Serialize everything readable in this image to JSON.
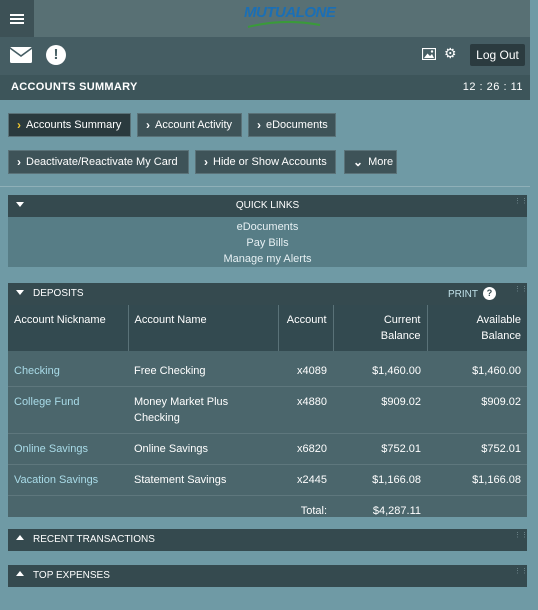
{
  "header": {
    "menu_icon": "hamburger-icon",
    "logo_text": "MUTUALONE",
    "logo_colors": {
      "text": "#1b6fb5",
      "swoosh": "#3a9a3a"
    }
  },
  "toolbar": {
    "mail_icon": "envelope-icon",
    "alert_icon": "exclamation-icon",
    "alert_glyph": "!",
    "image_icon": "image-icon",
    "gear_icon": "gear-icon",
    "logout_label": "Log Out"
  },
  "title_bar": {
    "title": "ACCOUNTS SUMMARY",
    "clock": "12 : 26 : 11"
  },
  "nav": {
    "row1": [
      {
        "label": "Accounts Summary",
        "active": true
      },
      {
        "label": "Account Activity",
        "active": false
      },
      {
        "label": "eDocuments",
        "active": false
      }
    ],
    "row2": [
      {
        "label": "Deactivate/Reactivate My Card"
      },
      {
        "label": "Hide or Show Accounts"
      },
      {
        "label": "More",
        "icon": "chevron-down-icon"
      }
    ]
  },
  "quick_links": {
    "title": "QUICK LINKS",
    "links": [
      "eDocuments",
      "Pay Bills",
      "Manage my Alerts"
    ]
  },
  "deposits": {
    "title": "DEPOSITS",
    "print_label": "PRINT",
    "help_glyph": "?",
    "columns": {
      "nickname": "Account Nickname",
      "name": "Account Name",
      "account": "Account",
      "current_1": "Current",
      "current_2": "Balance",
      "available_1": "Available",
      "available_2": "Balance"
    },
    "rows": [
      {
        "nickname": "Checking",
        "name_1": "Free Checking",
        "name_2": "",
        "account": "x4089",
        "current": "$1,460.00",
        "available": "$1,460.00"
      },
      {
        "nickname": "College Fund",
        "name_1": "Money Market Plus",
        "name_2": "Checking",
        "account": "x4880",
        "current": "$909.02",
        "available": "$909.02"
      },
      {
        "nickname": "Online Savings",
        "name_1": "Online Savings",
        "name_2": "",
        "account": "x6820",
        "current": "$752.01",
        "available": "$752.01"
      },
      {
        "nickname": "Vacation Savings",
        "name_1": "Statement Savings",
        "name_2": "",
        "account": "x2445",
        "current": "$1,166.08",
        "available": "$1,166.08"
      }
    ],
    "total_label": "Total:",
    "total_value": "$4,287.11"
  },
  "sections": {
    "recent": "RECENT TRANSACTIONS",
    "expenses": "TOP EXPENSES"
  },
  "colors": {
    "background": "#6f9aa5",
    "bar_dark": "#354a4f",
    "active_chevron": "#f0c830",
    "nickname_link": "#a9dbe8"
  }
}
